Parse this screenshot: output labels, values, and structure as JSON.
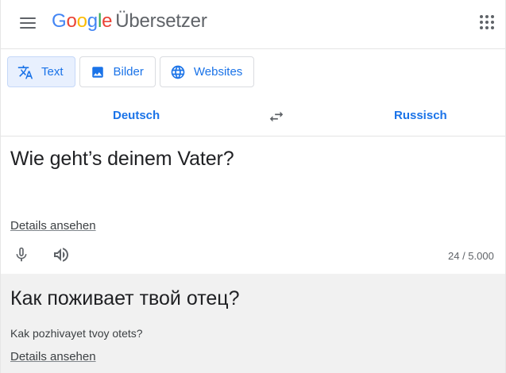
{
  "header": {
    "logo_letters": [
      "G",
      "o",
      "o",
      "g",
      "l",
      "e"
    ],
    "product_name": "Übersetzer",
    "menu_icon": "hamburger-menu-icon",
    "apps_icon": "apps-grid-icon"
  },
  "modes": [
    {
      "label": "Text",
      "icon": "translate-icon",
      "active": true
    },
    {
      "label": "Bilder",
      "icon": "image-icon",
      "active": false
    },
    {
      "label": "Websites",
      "icon": "globe-icon",
      "active": false
    }
  ],
  "languages": {
    "source": "Deutsch",
    "target": "Russisch",
    "swap_icon": "swap-arrows-icon"
  },
  "source": {
    "text": "Wie geht’s deinem Vater?",
    "details_link": "Details ansehen",
    "char_count": "24 / 5.000"
  },
  "result": {
    "text": "Как поживает твой отец?",
    "transliteration": "Kak pozhivayet tvoy otets?",
    "details_link": "Details ansehen"
  },
  "colors": {
    "accent": "#1a73e8",
    "active_mode_bg": "#e8f0fe",
    "result_bg": "#f1f1f1",
    "google_blue": "#4285f4",
    "google_red": "#ea4335",
    "google_yellow": "#fbbc05",
    "google_green": "#34a853"
  }
}
